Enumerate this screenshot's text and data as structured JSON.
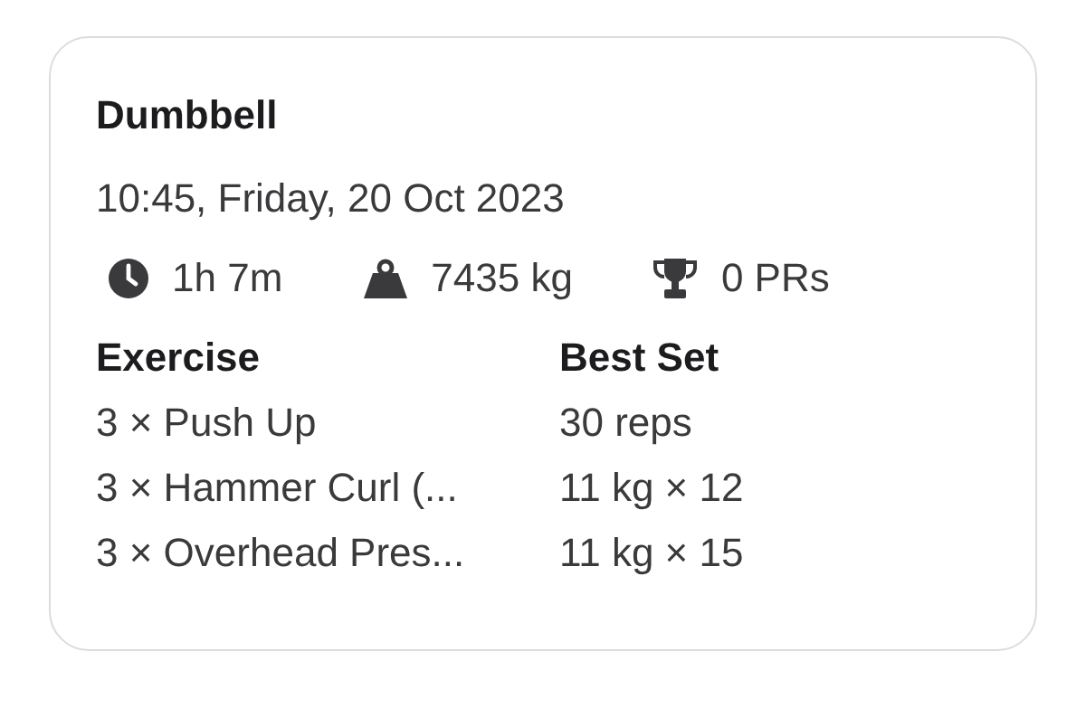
{
  "card": {
    "title": "Dumbbell",
    "datetime": "10:45, Friday, 20 Oct 2023",
    "stats": [
      {
        "kind": "duration",
        "text": "1h 7m"
      },
      {
        "kind": "weight",
        "text": "7435 kg"
      },
      {
        "kind": "prs",
        "text": "0 PRs"
      }
    ],
    "table": {
      "columns": [
        "Exercise",
        "Best Set"
      ],
      "rows": [
        [
          "3 × Push Up",
          "30 reps"
        ],
        [
          "3 × Hammer Curl (...",
          "11 kg × 12"
        ],
        [
          "3 × Overhead Pres...",
          "11 kg × 15"
        ]
      ]
    }
  }
}
